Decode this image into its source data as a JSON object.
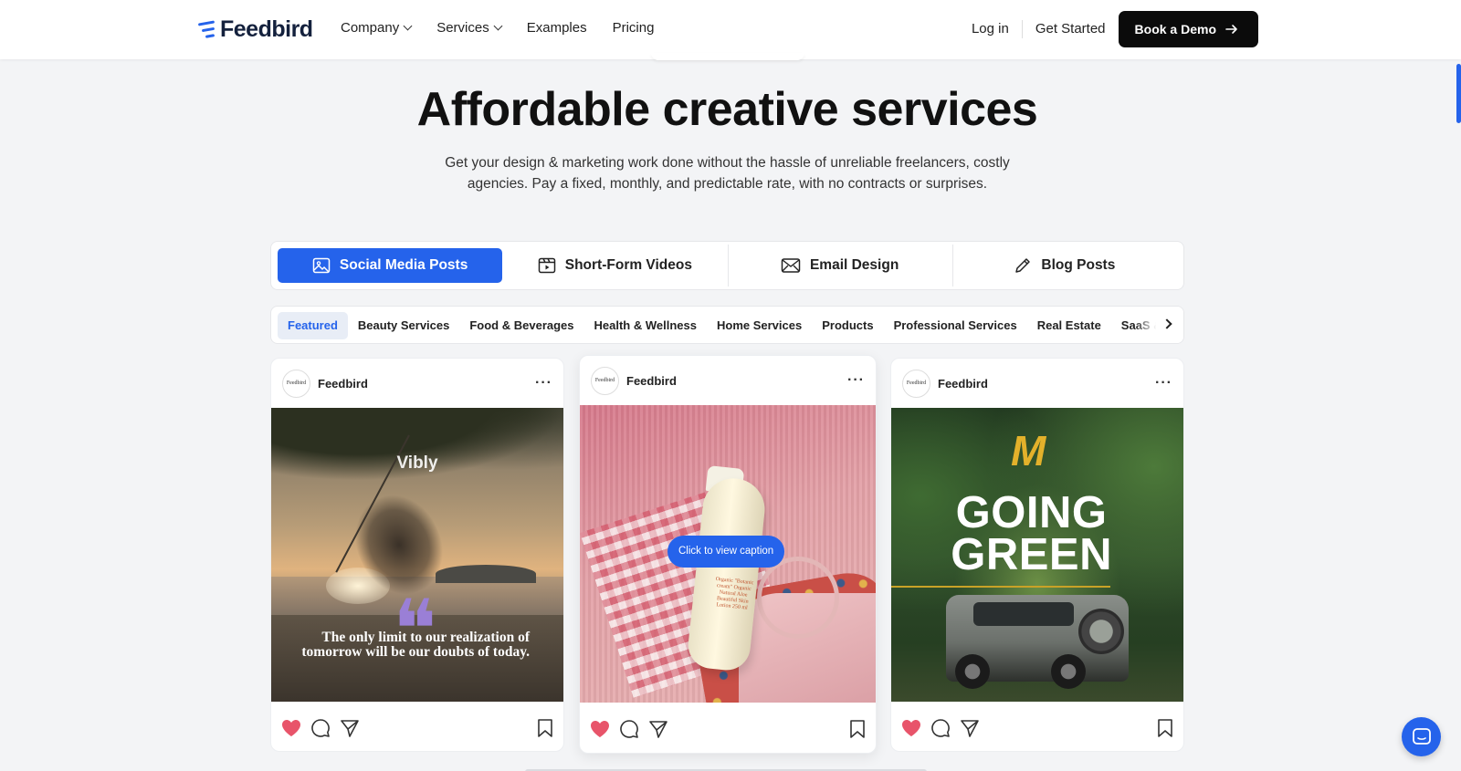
{
  "brand": {
    "name": "Feedbird",
    "accent": "#2563eb"
  },
  "nav": {
    "links": [
      {
        "label": "Company",
        "dropdown": true
      },
      {
        "label": "Services",
        "dropdown": true
      },
      {
        "label": "Examples",
        "dropdown": false
      },
      {
        "label": "Pricing",
        "dropdown": false
      }
    ],
    "login": "Log in",
    "get_started": "Get Started",
    "demo": "Book a Demo"
  },
  "hero": {
    "title": "Affordable creative services",
    "subtitle": "Get your design & marketing work done without the hassle of unreliable freelancers, costly agencies. Pay a fixed, monthly, and predictable rate, with no contracts or surprises."
  },
  "tabs": [
    {
      "label": "Social Media Posts",
      "icon": "image-icon",
      "active": true
    },
    {
      "label": "Short-Form Videos",
      "icon": "video-icon",
      "active": false
    },
    {
      "label": "Email Design",
      "icon": "mail-icon",
      "active": false
    },
    {
      "label": "Blog Posts",
      "icon": "pencil-icon",
      "active": false
    }
  ],
  "categories": [
    {
      "label": "Featured",
      "active": true
    },
    {
      "label": "Beauty Services",
      "active": false
    },
    {
      "label": "Food & Beverages",
      "active": false
    },
    {
      "label": "Health & Wellness",
      "active": false
    },
    {
      "label": "Home Services",
      "active": false
    },
    {
      "label": "Products",
      "active": false
    },
    {
      "label": "Professional Services",
      "active": false
    },
    {
      "label": "Real Estate",
      "active": false
    },
    {
      "label": "SaaS & Tec",
      "active": false
    }
  ],
  "posts": [
    {
      "account": "Feedbird",
      "avatar_text": "Feedbird",
      "media_brand": "Vibly",
      "quote": "The only limit to our realization of tomorrow will be our doubts of today.",
      "liked": true
    },
    {
      "account": "Feedbird",
      "avatar_text": "Feedbird",
      "caption_button": "Click to view caption",
      "bottle_label": "Organic \"Botanic cream\" Organic Natural Aloe Beautiful Skin Lotion 250 ml",
      "liked": true
    },
    {
      "account": "Feedbird",
      "avatar_text": "Feedbird",
      "headline": "GOING GREEN",
      "logo_letter": "M",
      "liked": true
    }
  ],
  "colors": {
    "like": "#e8546a",
    "dark": "#0b0b0b",
    "page_bg": "#f3f4f6"
  }
}
